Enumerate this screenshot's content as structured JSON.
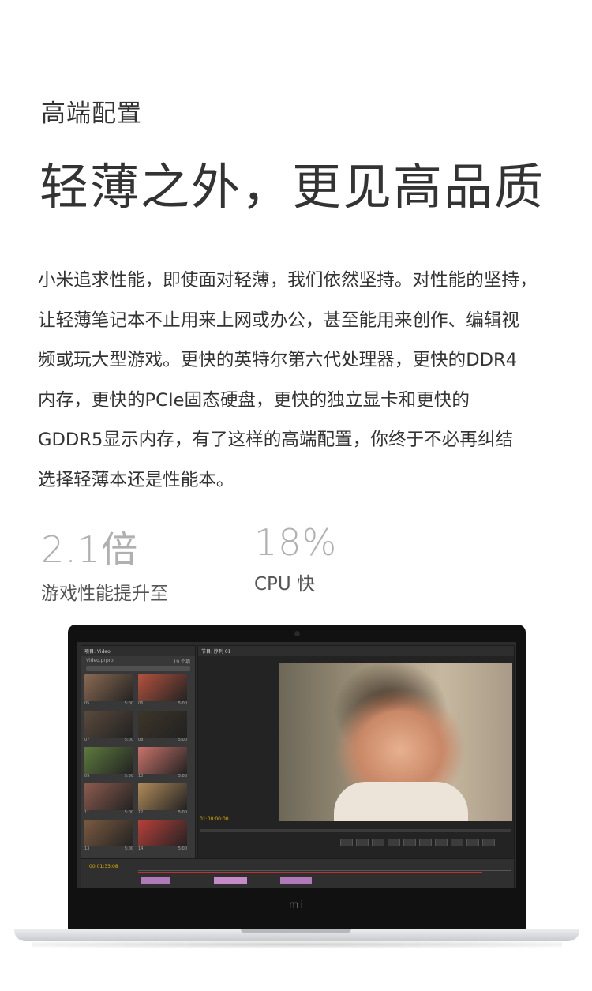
{
  "section": {
    "eyebrow": "高端配置",
    "headline": "轻薄之外，更见高品质",
    "body_lines": [
      "小米追求性能，即使面对轻薄，我们依然坚持。对性能的坚持，",
      "让轻薄笔记本不止用来上网或办公，甚至能用来创作、编辑视",
      "频或玩大型游戏。更快的英特尔第六代处理器，更快的DDR4",
      "内存，更快的PCIe固态硬盘，更快的独立显卡和更快的",
      "GDDR5显示内存，有了这样的高端配置，你终于不必再纠结",
      "选择轻薄本还是性能本。"
    ]
  },
  "stats": [
    {
      "value": "2.1倍",
      "label": "游戏性能提升至"
    },
    {
      "value": "18%",
      "label": "CPU 快"
    }
  ],
  "laptop": {
    "logo": "mi",
    "editor": {
      "project_tab": "项目: Video",
      "project_file": "Video.prproj",
      "item_count": "19 个项",
      "monitor_tab": "节目: 序列 01",
      "monitor_timecode": "01:00:00:00",
      "timeline_timecode": "00:01:33:08",
      "thumbs": [
        {
          "num": "05",
          "dur": "5:00",
          "color": "#8a6a52"
        },
        {
          "num": "06",
          "dur": "5:00",
          "color": "#b3523e"
        },
        {
          "num": "07",
          "dur": "5:00",
          "color": "#5a4a3c"
        },
        {
          "num": "08",
          "dur": "5:00",
          "color": "#3d3528"
        },
        {
          "num": "09",
          "dur": "5:00",
          "color": "#5d7a3e"
        },
        {
          "num": "10",
          "dur": "5:00",
          "color": "#c9736a"
        },
        {
          "num": "11",
          "dur": "5:00",
          "color": "#8c5b4e"
        },
        {
          "num": "12",
          "dur": "5:00",
          "color": "#b08a5a"
        },
        {
          "num": "13",
          "dur": "5:00",
          "color": "#7a5a40"
        },
        {
          "num": "14",
          "dur": "5:00",
          "color": "#b8403a"
        }
      ]
    }
  }
}
